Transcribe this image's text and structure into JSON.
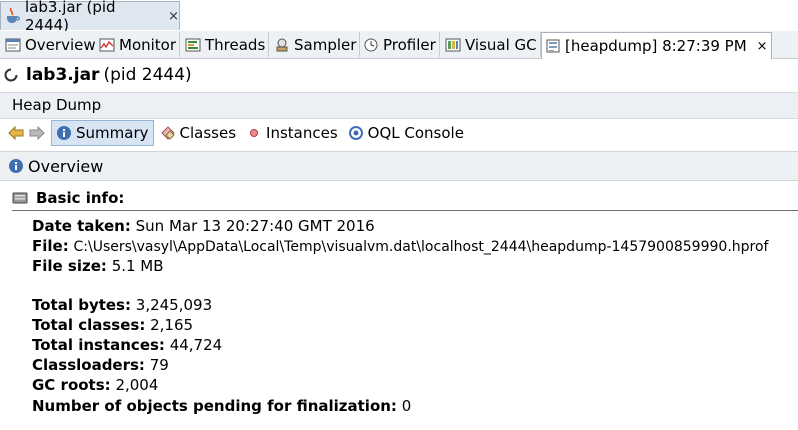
{
  "document_tab": {
    "title": "lab3.jar (pid 2444)",
    "close": "×"
  },
  "sub_tabs": [
    {
      "label": "Overview",
      "icon": "overview-icon"
    },
    {
      "label": "Monitor",
      "icon": "monitor-icon"
    },
    {
      "label": "Threads",
      "icon": "threads-icon"
    },
    {
      "label": "Sampler",
      "icon": "sampler-icon"
    },
    {
      "label": "Profiler",
      "icon": "profiler-icon"
    },
    {
      "label": "Visual GC",
      "icon": "visual-gc-icon"
    },
    {
      "label": "[heapdump] 8:27:39 PM",
      "icon": "heapdump-icon",
      "active": true,
      "close": "×"
    }
  ],
  "title": {
    "app": "lab3.jar",
    "pid": "(pid 2444)"
  },
  "heap_dump_label": "Heap Dump",
  "nav": {
    "summary": "Summary",
    "classes": "Classes",
    "instances": "Instances",
    "oql": "OQL Console"
  },
  "overview_label": "Overview",
  "basic_info": {
    "heading": "Basic info:",
    "date_taken_label": "Date taken:",
    "date_taken": "Sun Mar 13 20:27:40 GMT 2016",
    "file_label": "File:",
    "file": "C:\\Users\\vasyl\\AppData\\Local\\Temp\\visualvm.dat\\localhost_2444\\heapdump-1457900859990.hprof",
    "file_size_label": "File size:",
    "file_size": "5.1 MB",
    "total_bytes_label": "Total bytes:",
    "total_bytes": "3,245,093",
    "total_classes_label": "Total classes:",
    "total_classes": "2,165",
    "total_instances_label": "Total instances:",
    "total_instances": "44,724",
    "classloaders_label": "Classloaders:",
    "classloaders": "79",
    "gc_roots_label": "GC roots:",
    "gc_roots": "2,004",
    "pending_label": "Number of objects pending for finalization:",
    "pending": "0"
  }
}
